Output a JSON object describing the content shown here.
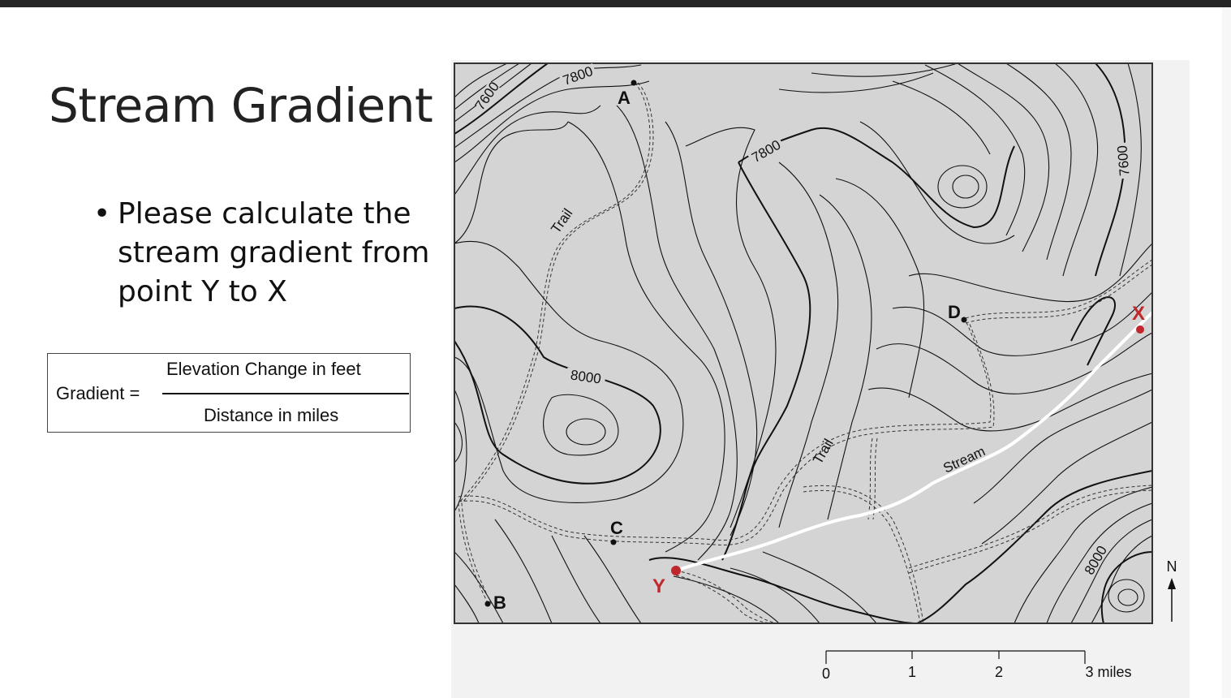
{
  "slide": {
    "title": "Stream Gradient",
    "bullets": [
      "Please calculate the stream gradient from point Y to X"
    ],
    "bullet_symbol": "•"
  },
  "formula": {
    "lhs": "Gradient =",
    "numerator": "Elevation Change in feet",
    "denominator": "Distance in miles"
  },
  "map": {
    "contour_labels": [
      "7600",
      "7800",
      "7800",
      "8000",
      "7600",
      "8000"
    ],
    "points": {
      "A": "A",
      "B": "B",
      "C": "C",
      "D": "D",
      "X": "X",
      "Y": "Y"
    },
    "trail_labels": [
      "Trail",
      "Trail"
    ],
    "stream_label": "Stream",
    "scale": {
      "ticks": [
        "0",
        "1",
        "2"
      ],
      "end_label": "3 miles"
    },
    "north_label": "N",
    "colors": {
      "map_fill": "#d4d4d4",
      "contour": "#111111",
      "marker_red": "#c0272d",
      "stream": "#ffffff"
    }
  }
}
